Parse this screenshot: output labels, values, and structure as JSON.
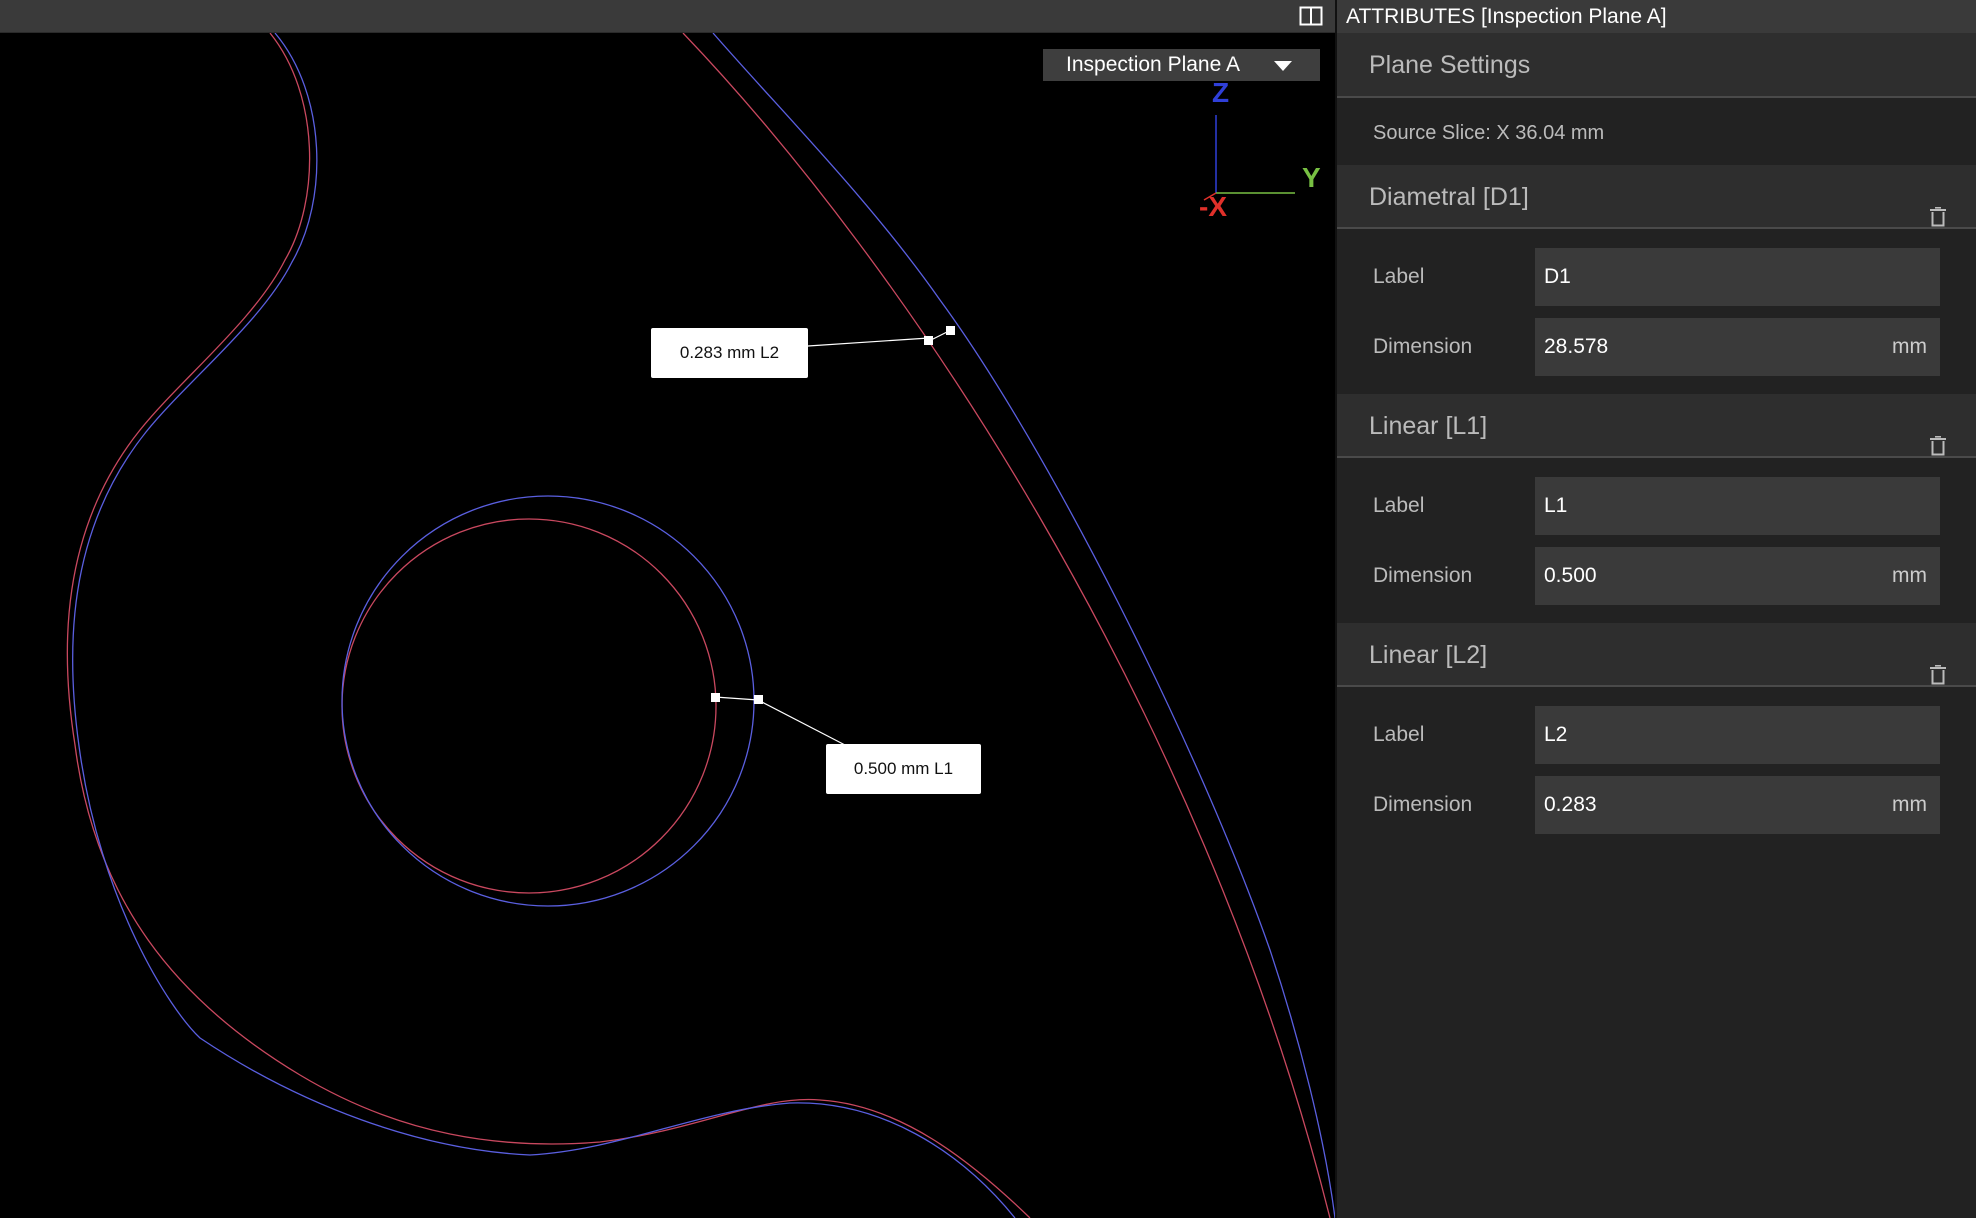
{
  "viewport": {
    "plane_selector": {
      "label": "Inspection Plane A"
    },
    "axes": {
      "z": "Z",
      "y": "Y",
      "x": "-X"
    },
    "callouts": {
      "l2": "0.283 mm L2",
      "l1": "0.500 mm L1"
    },
    "colors": {
      "nominal": "#c9485f",
      "measured": "#5a5fe0",
      "background": "#000000"
    }
  },
  "panel": {
    "title": "ATTRIBUTES [Inspection Plane A]",
    "plane_settings": {
      "title": "Plane Settings",
      "source_slice": "Source Slice: X 36.04 mm"
    },
    "sections": [
      {
        "title": "Diametral [D1]",
        "label_caption": "Label",
        "label_value": "D1",
        "dimension_caption": "Dimension",
        "dimension_value": "28.578",
        "unit": "mm"
      },
      {
        "title": "Linear [L1]",
        "label_caption": "Label",
        "label_value": "L1",
        "dimension_caption": "Dimension",
        "dimension_value": "0.500",
        "unit": "mm"
      },
      {
        "title": "Linear [L2]",
        "label_caption": "Label",
        "label_value": "L2",
        "dimension_caption": "Dimension",
        "dimension_value": "0.283",
        "unit": "mm"
      }
    ]
  }
}
